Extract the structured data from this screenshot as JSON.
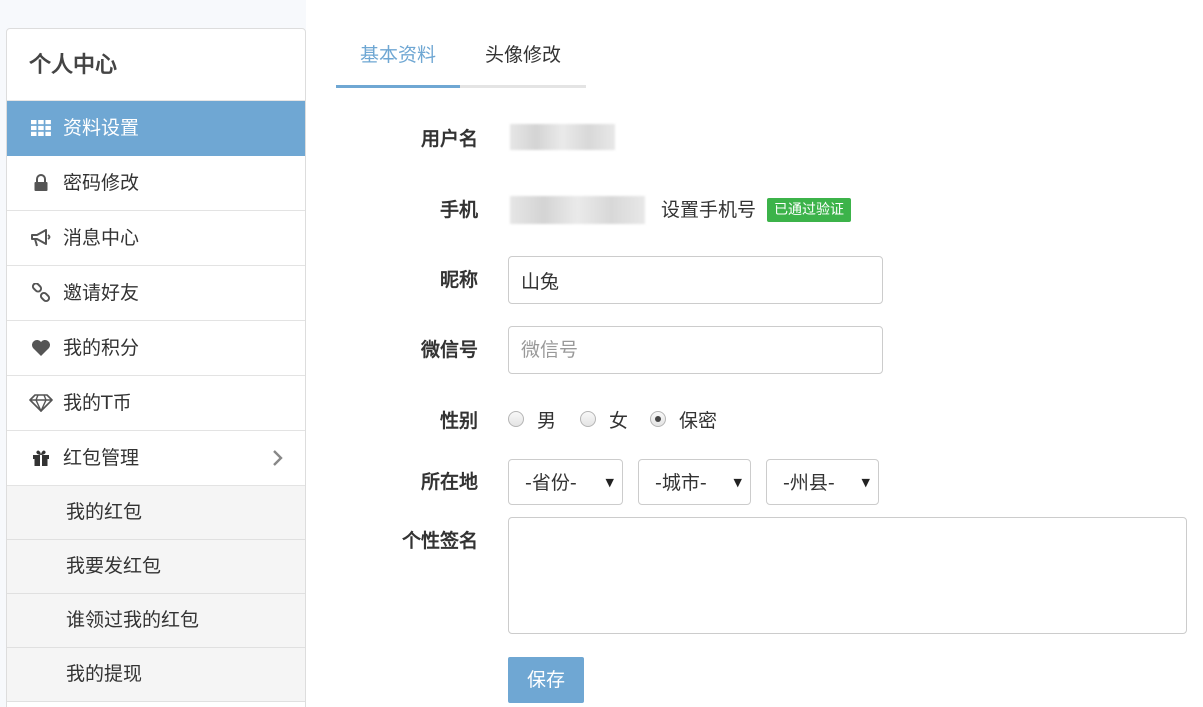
{
  "sidebar": {
    "title": "个人中心",
    "items": [
      {
        "label": "资料设置",
        "icon": "grid-icon"
      },
      {
        "label": "密码修改",
        "icon": "lock-icon"
      },
      {
        "label": "消息中心",
        "icon": "megaphone-icon"
      },
      {
        "label": "邀请好友",
        "icon": "link-icon"
      },
      {
        "label": "我的积分",
        "icon": "heart-icon"
      },
      {
        "label": "我的T币",
        "icon": "diamond-icon"
      },
      {
        "label": "红包管理",
        "icon": "gift-icon"
      }
    ],
    "subitems": [
      {
        "label": "我的红包"
      },
      {
        "label": "我要发红包"
      },
      {
        "label": "谁领过我的红包"
      },
      {
        "label": "我的提现"
      }
    ]
  },
  "tabs": [
    {
      "label": "基本资料"
    },
    {
      "label": "头像修改"
    }
  ],
  "form": {
    "username_label": "用户名",
    "phone_label": "手机",
    "set_phone_text": "设置手机号",
    "verified_badge": "已通过验证",
    "nickname_label": "昵称",
    "nickname_value": "山兔",
    "wechat_label": "微信号",
    "wechat_placeholder": "微信号",
    "gender_label": "性别",
    "gender_options": [
      {
        "label": "男",
        "checked": false
      },
      {
        "label": "女",
        "checked": false
      },
      {
        "label": "保密",
        "checked": true
      }
    ],
    "location_label": "所在地",
    "province_select": "-省份-",
    "city_select": "-城市-",
    "county_select": "-州县-",
    "signature_label": "个性签名",
    "save_label": "保存"
  },
  "colors": {
    "accent": "#6fa7d3",
    "verified": "#3cb34a"
  }
}
